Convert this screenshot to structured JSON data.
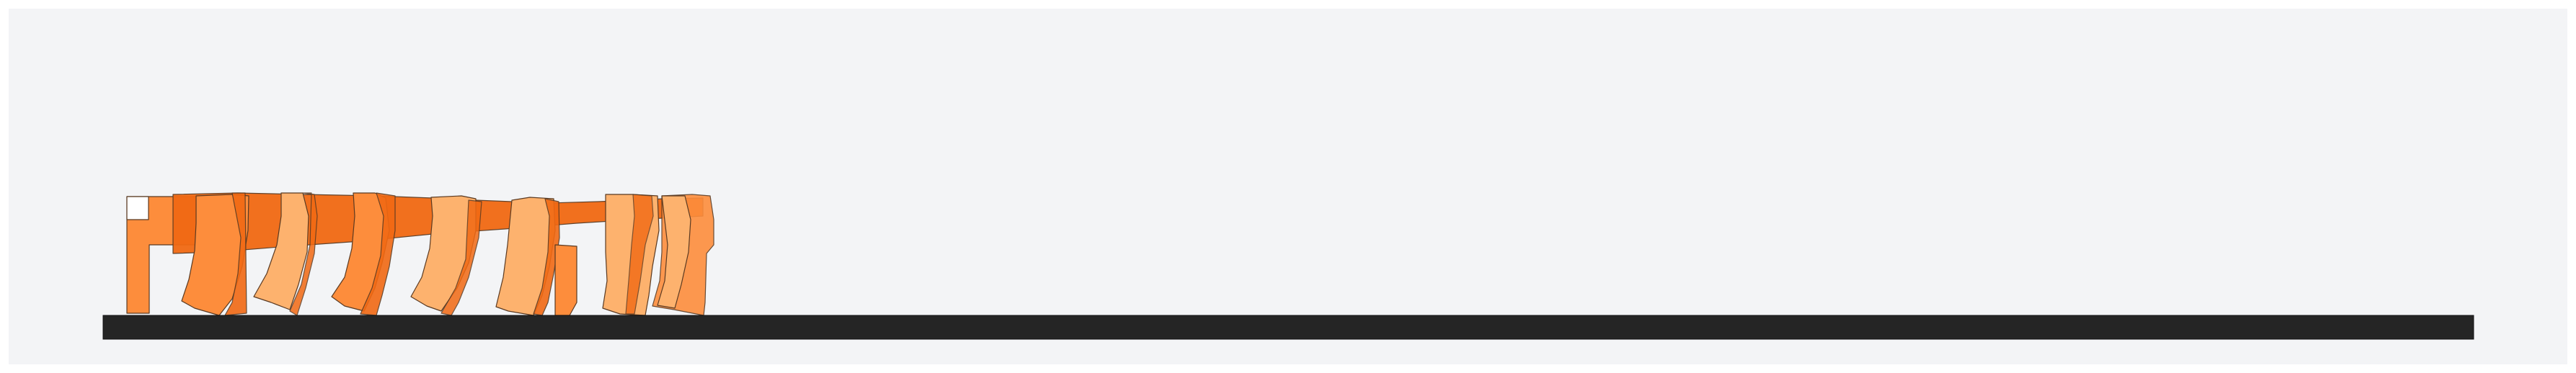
{
  "colors": {
    "page_background": "#ffffff",
    "canvas_background": "#f3f4f6",
    "base_bar": "#252525",
    "shape_outline": "#5a3a22",
    "orange_light": "#fdb26e",
    "orange_mid": "#fd8d3c",
    "orange_dark": "#f16913"
  },
  "icons": {
    "ground": "horizontal-bar",
    "figures": "overlapping-bent-columns"
  }
}
